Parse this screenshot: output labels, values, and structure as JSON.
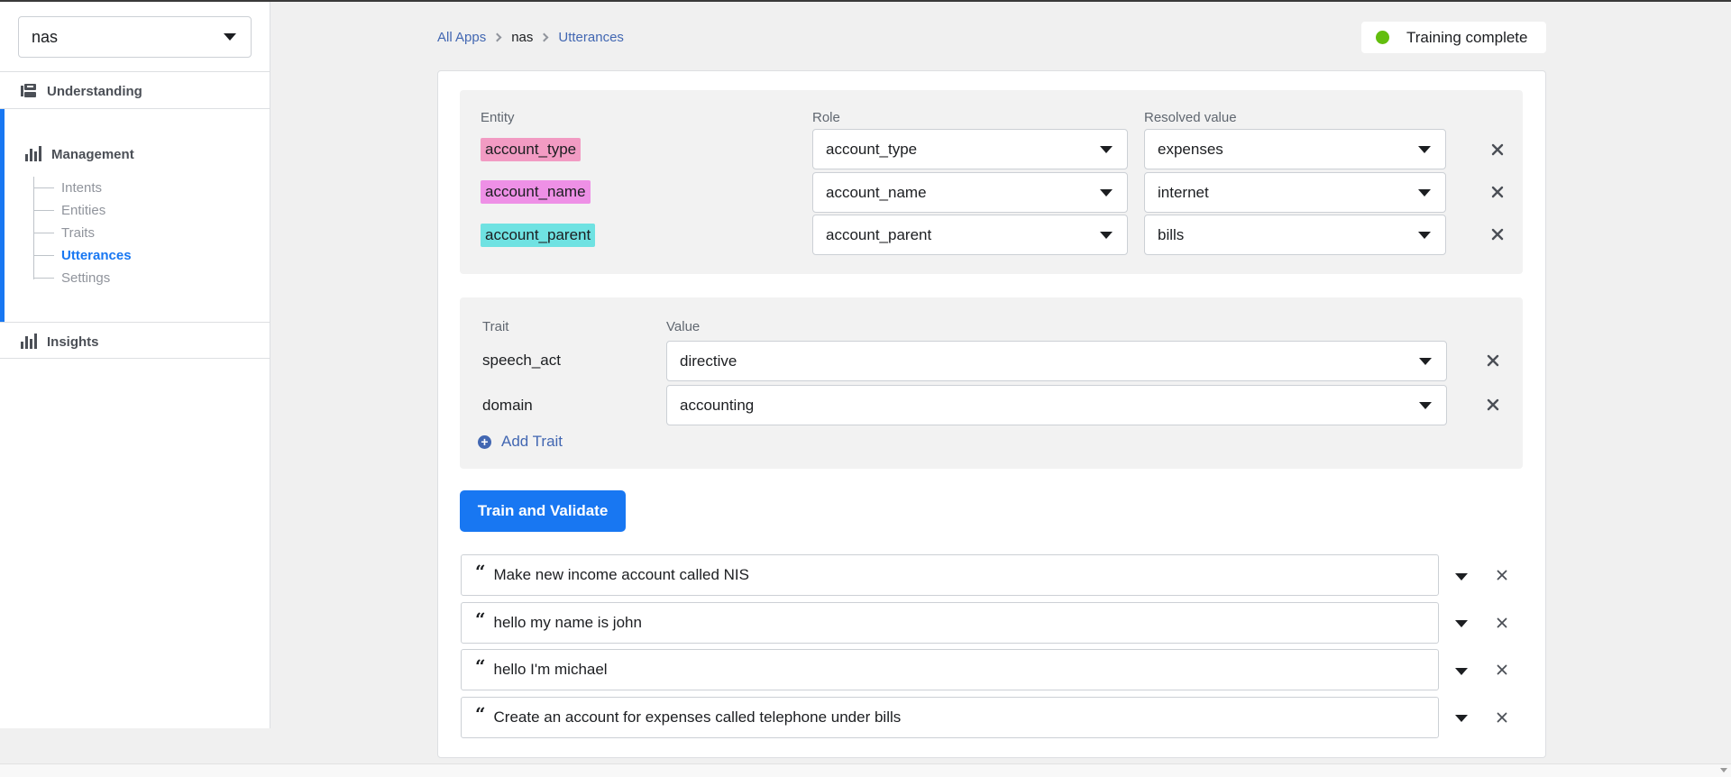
{
  "app_selector": {
    "value": "nas"
  },
  "sidebar": {
    "understanding": "Understanding",
    "management": "Management",
    "management_items": [
      {
        "label": "Intents"
      },
      {
        "label": "Entities"
      },
      {
        "label": "Traits"
      },
      {
        "label": "Utterances"
      },
      {
        "label": "Settings"
      }
    ],
    "insights": "Insights"
  },
  "breadcrumb": {
    "all_apps": "All Apps",
    "app": "nas",
    "current": "Utterances"
  },
  "status": {
    "label": "Training complete",
    "color": "#63be0e"
  },
  "entities_panel": {
    "headers": {
      "entity": "Entity",
      "role": "Role",
      "resolved": "Resolved value"
    },
    "rows": [
      {
        "entity": "account_type",
        "color": "#f29bc3",
        "role": "account_type",
        "resolved": "expenses"
      },
      {
        "entity": "account_name",
        "color": "#ee90e6",
        "role": "account_name",
        "resolved": "internet"
      },
      {
        "entity": "account_parent",
        "color": "#6fe2e2",
        "role": "account_parent",
        "resolved": "bills"
      }
    ]
  },
  "traits_panel": {
    "headers": {
      "trait": "Trait",
      "value": "Value"
    },
    "rows": [
      {
        "trait": "speech_act",
        "value": "directive"
      },
      {
        "trait": "domain",
        "value": "accounting"
      }
    ],
    "add_label": "Add Trait"
  },
  "train_button": "Train and Validate",
  "utterances": [
    {
      "text": "Make new income account called NIS"
    },
    {
      "text": "hello my name is john"
    },
    {
      "text": "hello I'm michael"
    },
    {
      "text": "Create an account for expenses called telephone under bills"
    }
  ]
}
